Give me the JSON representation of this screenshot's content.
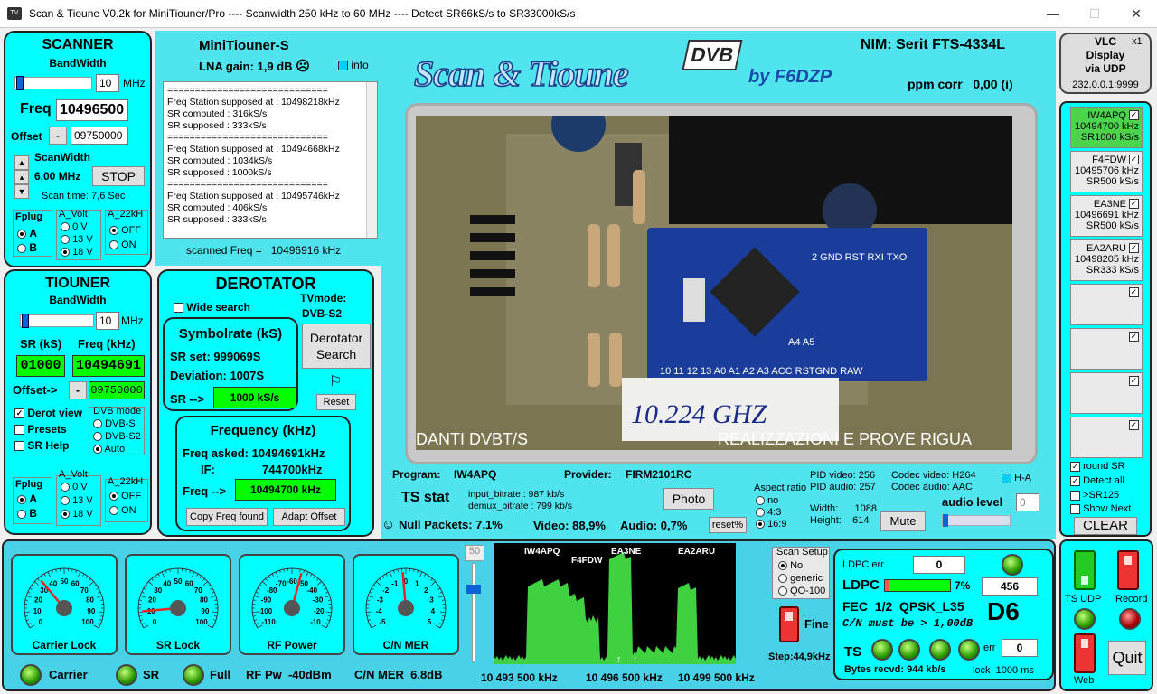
{
  "window": {
    "title": "Scan & Tioune V0.2k for MiniTiouner/Pro ---- Scanwidth 250 kHz to 60 MHz ---- Detect SR66kS/s to SR33000kS/s",
    "min": "—",
    "max": "☐",
    "close": "✕"
  },
  "scanner": {
    "title": "SCANNER",
    "bw_label": "BandWidth",
    "bw_value": "10",
    "bw_unit": "MHz",
    "freq_label": "Freq",
    "freq_value": "10496500",
    "offset_label": "Offset",
    "offset_sign": "-",
    "offset_value": "09750000",
    "scanwidth_label": "ScanWidth",
    "scanwidth_value": "6,00 MHz",
    "stop": "STOP",
    "scan_time": "Scan time: 7,6 Sec",
    "fplug": {
      "label": "Fplug",
      "a": "A",
      "b": "B"
    },
    "avolt": {
      "label": "A_Volt",
      "v0": "0 V",
      "v13": "13 V",
      "v18": "18 V"
    },
    "a22": {
      "label": "A_22kH",
      "off": "OFF",
      "on": "ON"
    }
  },
  "tiouner": {
    "title": "TIOUNER",
    "bw_label": "BandWidth",
    "bw_value": "10",
    "bw_unit": "MHz",
    "sr_label": "SR (kS)",
    "freq_label": "Freq (kHz)",
    "sr_value": "01000",
    "freq_value": "10494691",
    "offset_label": "Offset->",
    "offset_sign": "-",
    "offset_value": "09750000",
    "derot_view": "Derot view",
    "presets": "Presets",
    "sr_help": "SR Help",
    "dvb_label": "DVB mode",
    "dvbs": "DVB-S",
    "dvbs2": "DVB-S2",
    "auto": "Auto",
    "fplug": {
      "label": "Fplug",
      "a": "A",
      "b": "B"
    },
    "avolt": {
      "label": "A_Volt",
      "v0": "0 V",
      "v13": "13 V",
      "v18": "18 V"
    },
    "a22": {
      "label": "A_22kH",
      "off": "OFF",
      "on": "ON"
    }
  },
  "mini": {
    "title": "MiniTiouner-S",
    "lna": "LNA gain: 1,9 dB",
    "info": "info",
    "scanned": "scanned Freq =   10496916 kHz",
    "log": [
      "=============================",
      "Freq Station supposed at : 10498218kHz",
      "SR computed : 316kS/s",
      "SR supposed : 333kS/s",
      "=============================",
      "Freq Station supposed at : 10494668kHz",
      "SR computed : 1034kS/s",
      "SR supposed : 1000kS/s",
      "=============================",
      "Freq Station supposed at : 10495746kHz",
      "SR computed : 406kS/s",
      "SR supposed : 333kS/s"
    ]
  },
  "derot": {
    "title": "DEROTATOR",
    "wide": "Wide search",
    "tvmode": "TVmode:",
    "tvmode_val": "DVB-S2",
    "sym_title": "Symbolrate (kS)",
    "sr_set": "SR set:  999069S",
    "deviation": "Deviation:  1007S",
    "sr_arrow": "SR -->",
    "sr_val": "1000 kS/s",
    "derot_btn": "Derotator Search",
    "reset": "Reset",
    "freq_title": "Frequency (kHz)",
    "freq_asked": "Freq asked:  10494691kHz",
    "if_label": "IF:",
    "if_val": "744700kHz",
    "freq_arrow": "Freq -->",
    "freq_val": "10494700 kHz",
    "copy": "Copy Freq found",
    "adapt": "Adapt Offset"
  },
  "header": {
    "logo": "Scan & Tioune",
    "dvb": "DVB",
    "by": "by F6DZP",
    "nim": "NIM:  Serit FTS-4334L",
    "ppm": "ppm corr   0,00 (i)"
  },
  "video": {
    "overlay_left": "DANTI DVBT/S",
    "overlay_right": "REALIZZAZIONI E PROVE RIGUA",
    "handwritten": "10.224 GHZ",
    "pins_top": "2   GND RST RXI TXO",
    "pins_mid": "A4 A5",
    "pins_bottom": "10 11 12 13  A0  A1  A2  A3  ACC RSTGND RAW"
  },
  "status": {
    "program_label": "Program:",
    "program": "IW4APQ",
    "provider_label": "Provider:",
    "provider": "FIRM2101RC",
    "ts_stat": "TS stat",
    "input_bitrate": "input_bitrate :   987 kb/s",
    "demux_bitrate": "demux_bitrate :  799 kb/s",
    "photo": "Photo",
    "null": "Null Packets: 7,1%",
    "video": "Video: 88,9%",
    "audio": "Audio: 0,7%",
    "reset": "reset%",
    "aspect": "Aspect ratio",
    "ar_no": "no",
    "ar_43": "4:3",
    "ar_169": "16:9",
    "pid_video": "PID video:  256",
    "pid_audio": "PID audio:  257",
    "codec_video": "Codec video: H264",
    "codec_audio": "Codec audio:  AAC",
    "ha": "H-A",
    "width": "Width:      1088",
    "height": "Height:    614",
    "mute": "Mute",
    "audio_level": "audio level",
    "audio_val": "0"
  },
  "vlc": {
    "title": "VLC\nDisplay\nvia UDP",
    "x1": "x1",
    "ip": "232.0.0.1:9999"
  },
  "stations": [
    {
      "call": "IW4APQ",
      "freq": "10494700 kHz",
      "sr": "SR1000 kS/s",
      "active": true
    },
    {
      "call": "F4FDW",
      "freq": "10495706 kHz",
      "sr": "SR500 kS/s",
      "active": false
    },
    {
      "call": "EA3NE",
      "freq": "10496691 kHz",
      "sr": "SR500 kS/s",
      "active": false
    },
    {
      "call": "EA2ARU",
      "freq": "10498205 kHz",
      "sr": "SR333 kS/s",
      "active": false
    }
  ],
  "right_opts": {
    "round_sr": "round SR",
    "detect_all": "Detect all",
    "sr125": ">SR125",
    "show_next": "Show Next",
    "clear": "CLEAR"
  },
  "gauges": [
    {
      "label": "Carrier Lock",
      "ticks": [
        "0",
        "10",
        "20",
        "30",
        "40",
        "50",
        "60",
        "70",
        "80",
        "90",
        "100"
      ]
    },
    {
      "label": "SR Lock",
      "ticks": [
        "0",
        "10",
        "20",
        "30",
        "40",
        "50",
        "60",
        "70",
        "80",
        "90",
        "100"
      ]
    },
    {
      "label": "RF Power",
      "ticks": [
        "-110",
        "-100",
        "-90",
        "-80",
        "-70",
        "-60",
        "-50",
        "-40",
        "-30",
        "-20",
        "-10"
      ]
    },
    {
      "label": "C/N MER",
      "ticks": [
        "-5",
        "-4",
        "-3",
        "-2",
        "-1",
        "0",
        "1",
        "2",
        "3",
        "4",
        "5"
      ]
    }
  ],
  "leds": {
    "carrier": "Carrier",
    "sr": "SR",
    "full": "Full",
    "rf": "RF Pw  -40dBm",
    "cn": "C/N MER  6,8dB"
  },
  "spectrum": {
    "level": "50",
    "labels": [
      "IW4APQ",
      "F4FDW",
      "EA3NE",
      "EA2ARU"
    ],
    "f1": "10 493 500 kHz",
    "f2": "10 496 500 kHz",
    "f3": "10 499 500 kHz",
    "scan_setup": "Scan Setup",
    "no": "No",
    "generic": "generic",
    "qo": "QO-100",
    "fine": "Fine",
    "step": "Step:44,9kHz"
  },
  "ldpc": {
    "err_label": "LDPC err",
    "err_val": "0",
    "ldpc": "LDPC",
    "pct": "7%",
    "ldpc_val": "456",
    "fec": "FEC  1/2  QPSK_L35",
    "cn": "C/N must be > 1,00dB",
    "d6": "D6",
    "ts": "TS",
    "ts_err": "err",
    "ts_err_val": "0",
    "bytes": "Bytes recvd: 944 kb/s",
    "lock": "lock  1000 ms"
  },
  "controls": {
    "ts_udp": "TS UDP",
    "record": "Record",
    "web": "Web",
    "quit": "Quit"
  }
}
